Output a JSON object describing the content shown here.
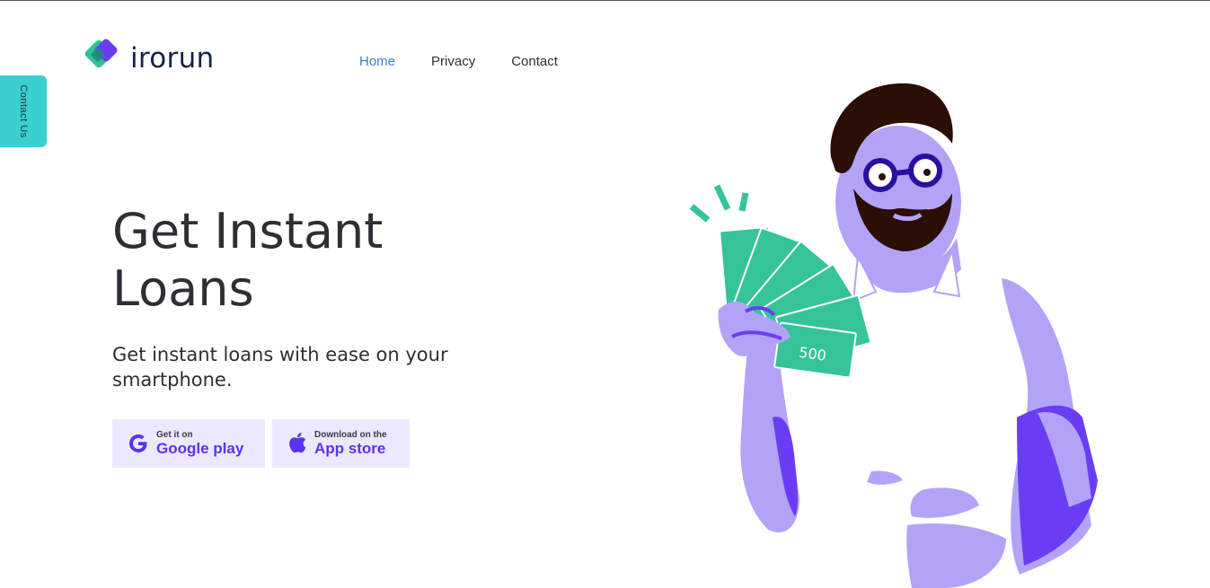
{
  "brand": {
    "name": "irorun",
    "colors": {
      "teal": "#2ec49a",
      "purple": "#6a3df5"
    }
  },
  "nav": {
    "items": [
      {
        "label": "Home",
        "active": true
      },
      {
        "label": "Privacy",
        "active": false
      },
      {
        "label": "Contact",
        "active": false
      }
    ]
  },
  "contact_tab": {
    "label": "Contact Us"
  },
  "hero": {
    "title": "Get Instant Loans",
    "subtitle": "Get instant loans with ease on your smartphone."
  },
  "downloads": {
    "google": {
      "small": "Get it on",
      "big": "Google play",
      "icon": "google-icon"
    },
    "apple": {
      "small": "Download on the",
      "big": "App store",
      "icon": "apple-icon"
    }
  },
  "illustration": {
    "banknote_value": "500"
  },
  "colors": {
    "accent_blue": "#3a7bd5",
    "button_bg": "#ece8fd",
    "button_text": "#5a32f0",
    "tab_bg": "#3ad0cf",
    "lavender": "#b3a3f7",
    "money_green": "#35c49a"
  }
}
